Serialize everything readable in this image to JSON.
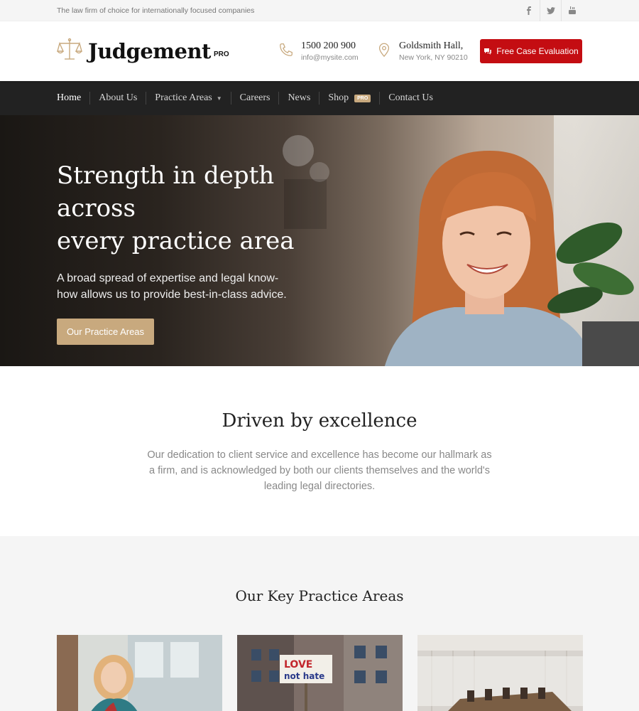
{
  "topbar": {
    "tagline": "The law firm of choice for internationally focused companies",
    "socials": [
      "facebook-icon",
      "twitter-icon",
      "youtube-icon"
    ]
  },
  "header": {
    "logo_text": "Judgement",
    "logo_badge": "PRO",
    "phone": "1500 200 900",
    "email": "info@mysite.com",
    "address_line1": "Goldsmith Hall,",
    "address_line2": "New York, NY 90210",
    "cta_label": "Free Case Evaluation"
  },
  "nav": {
    "items": [
      {
        "label": "Home"
      },
      {
        "label": "About Us"
      },
      {
        "label": "Practice Areas"
      },
      {
        "label": "Careers"
      },
      {
        "label": "News"
      },
      {
        "label": "Shop",
        "badge": "PRO"
      },
      {
        "label": "Contact Us"
      }
    ]
  },
  "hero": {
    "title_line1": "Strength in depth across",
    "title_line2": "every practice area",
    "subtitle": "A broad spread of expertise and legal know-how allows us to provide best-in-class advice.",
    "button_label": "Our Practice Areas"
  },
  "excellence": {
    "heading": "Driven by excellence",
    "body": "Our dedication to client service and excellence has become our hallmark as a firm, and is acknowledged by both our clients themselves and the world's leading legal directories."
  },
  "practice": {
    "heading": "Our Key Practice Areas",
    "sign_line1": "LOVE",
    "sign_line2": "not hate"
  },
  "colors": {
    "accent_gold": "#c8a97e",
    "cta_red": "#c40d12",
    "nav_bg": "#222222"
  }
}
